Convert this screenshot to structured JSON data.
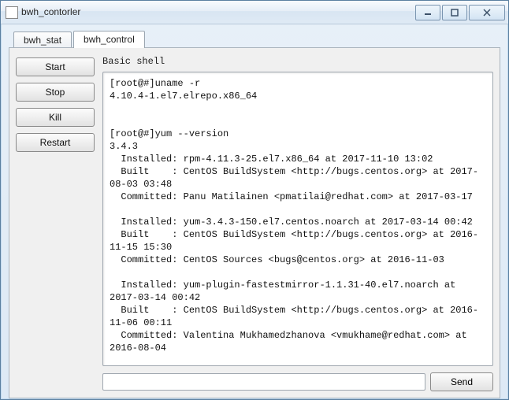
{
  "window": {
    "title": "bwh_contorler"
  },
  "tabs": [
    {
      "label": "bwh_stat"
    },
    {
      "label": "bwh_control"
    }
  ],
  "sidebar": {
    "start": "Start",
    "stop": "Stop",
    "kill": "Kill",
    "restart": "Restart"
  },
  "heading": "Basic shell",
  "terminal": "[root@#]uname -r\n4.10.4-1.el7.elrepo.x86_64\n\n\n[root@#]yum --version\n3.4.3\n  Installed: rpm-4.11.3-25.el7.x86_64 at 2017-11-10 13:02\n  Built    : CentOS BuildSystem <http://bugs.centos.org> at 2017-08-03 03:48\n  Committed: Panu Matilainen <pmatilai@redhat.com> at 2017-03-17\n\n  Installed: yum-3.4.3-150.el7.centos.noarch at 2017-03-14 00:42\n  Built    : CentOS BuildSystem <http://bugs.centos.org> at 2016-11-15 15:30\n  Committed: CentOS Sources <bugs@centos.org> at 2016-11-03\n\n  Installed: yum-plugin-fastestmirror-1.1.31-40.el7.noarch at 2017-03-14 00:42\n  Built    : CentOS BuildSystem <http://bugs.centos.org> at 2016-11-06 00:11\n  Committed: Valentina Mukhamedzhanova <vmukhame@redhat.com> at 2016-08-04\n",
  "input": {
    "value": "",
    "send": "Send"
  }
}
